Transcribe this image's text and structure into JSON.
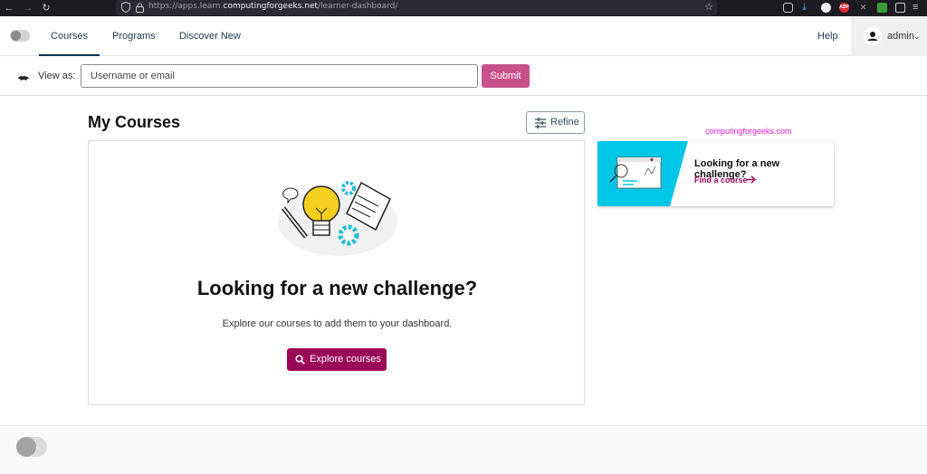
{
  "browser": {
    "url_prefix": "https://apps.learn.",
    "url_host": "computingforgeeks.net",
    "url_path": "/learner-dashboard/",
    "extension_badge": "ABP"
  },
  "header": {
    "tabs": [
      {
        "label": "Courses",
        "active": true
      },
      {
        "label": "Programs",
        "active": false
      },
      {
        "label": "Discover New",
        "active": false
      }
    ],
    "help_label": "Help",
    "user_name": "admin"
  },
  "masquerade": {
    "label": "View as:",
    "placeholder": "Username or email",
    "submit_label": "Submit"
  },
  "main": {
    "title": "My Courses",
    "refine_label": "Refine",
    "empty_heading": "Looking for a new challenge?",
    "empty_text": "Explore our courses to add them to your dashboard.",
    "explore_label": "Explore courses"
  },
  "sidebar": {
    "watermark": "computingforgeeks.com",
    "card_title": "Looking for a new challenge?",
    "card_link": "Find a course"
  },
  "colors": {
    "accent": "#9c0859",
    "submit": "#c9518b",
    "cyan": "#00c6e6",
    "watermark": "#e01fd6"
  }
}
